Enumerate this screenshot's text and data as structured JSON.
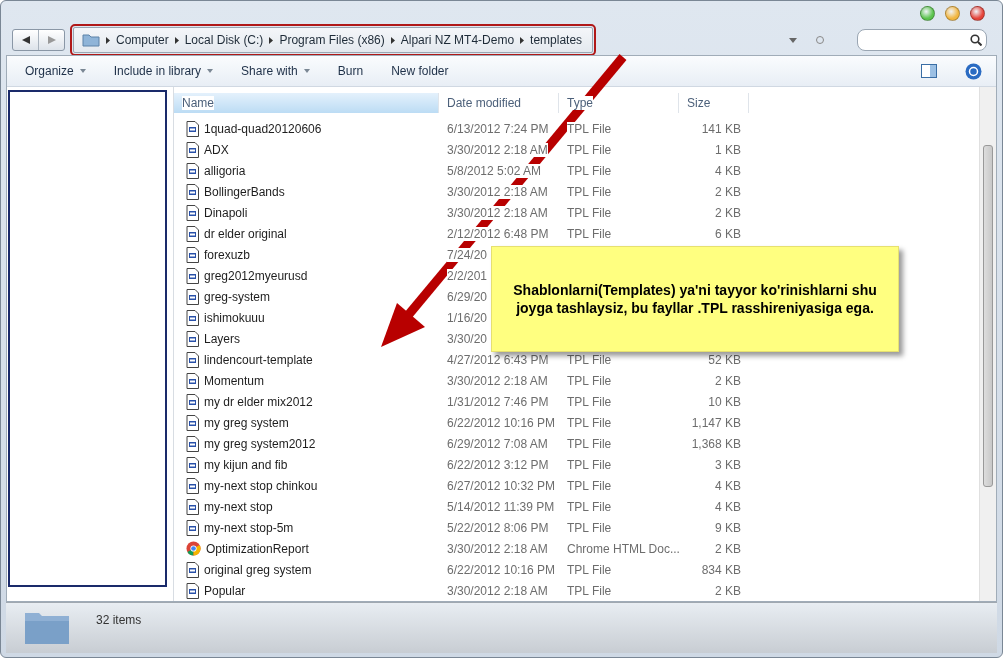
{
  "address": {
    "crumbs": [
      "Computer",
      "Local Disk (C:)",
      "Program Files (x86)",
      "Alpari NZ MT4-Demo",
      "templates"
    ]
  },
  "toolbar": [
    {
      "label": "Organize",
      "dropdown": true
    },
    {
      "label": "Include in library",
      "dropdown": true
    },
    {
      "label": "Share with",
      "dropdown": true
    },
    {
      "label": "Burn",
      "dropdown": false
    },
    {
      "label": "New folder",
      "dropdown": false
    }
  ],
  "columns": [
    {
      "label": "Name",
      "selected": true
    },
    {
      "label": "Date modified",
      "selected": false
    },
    {
      "label": "Type",
      "selected": false
    },
    {
      "label": "Size",
      "selected": false
    }
  ],
  "rows": [
    {
      "kind": "tpl",
      "name": "1quad-quad20120606",
      "date": "6/13/2012 7:24 PM",
      "type": "TPL File",
      "size": "141 KB"
    },
    {
      "kind": "tpl",
      "name": "ADX",
      "date": "3/30/2012 2:18 AM",
      "type": "TPL File",
      "size": "1 KB"
    },
    {
      "kind": "tpl",
      "name": "alligoria",
      "date": "5/8/2012 5:02 AM",
      "type": "TPL File",
      "size": "4 KB"
    },
    {
      "kind": "tpl",
      "name": "BollingerBands",
      "date": "3/30/2012 2:18 AM",
      "type": "TPL File",
      "size": "2 KB"
    },
    {
      "kind": "tpl",
      "name": "Dinapoli",
      "date": "3/30/2012 2:18 AM",
      "type": "TPL File",
      "size": "2 KB"
    },
    {
      "kind": "tpl",
      "name": "dr elder original",
      "date": "2/12/2012 6:48 PM",
      "type": "TPL File",
      "size": "6 KB"
    },
    {
      "kind": "tpl",
      "name": "forexuzb",
      "date": "7/24/20"
    },
    {
      "kind": "tpl",
      "name": "greg2012myeurusd",
      "date": "2/2/201"
    },
    {
      "kind": "tpl",
      "name": "greg-system",
      "date": "6/29/20"
    },
    {
      "kind": "tpl",
      "name": "ishimokuuu",
      "date": "1/16/20"
    },
    {
      "kind": "tpl",
      "name": "Layers",
      "date": "3/30/20"
    },
    {
      "kind": "tpl",
      "name": "lindencourt-template",
      "date": "4/27/2012 6:43 PM",
      "type": "TPL File",
      "size": "52 KB"
    },
    {
      "kind": "tpl",
      "name": "Momentum",
      "date": "3/30/2012 2:18 AM",
      "type": "TPL File",
      "size": "2 KB"
    },
    {
      "kind": "tpl",
      "name": "my dr elder mix2012",
      "date": "1/31/2012 7:46 PM",
      "type": "TPL File",
      "size": "10 KB"
    },
    {
      "kind": "tpl",
      "name": "my greg system",
      "date": "6/22/2012 10:16 PM",
      "type": "TPL File",
      "size": "1,147 KB"
    },
    {
      "kind": "tpl",
      "name": "my greg system2012",
      "date": "6/29/2012 7:08 AM",
      "type": "TPL File",
      "size": "1,368 KB"
    },
    {
      "kind": "tpl",
      "name": "my kijun and fib",
      "date": "6/22/2012 3:12 PM",
      "type": "TPL File",
      "size": "3 KB"
    },
    {
      "kind": "tpl",
      "name": "my-next stop chinkou",
      "date": "6/27/2012 10:32 PM",
      "type": "TPL File",
      "size": "4 KB"
    },
    {
      "kind": "tpl",
      "name": "my-next stop",
      "date": "5/14/2012 11:39 PM",
      "type": "TPL File",
      "size": "4 KB"
    },
    {
      "kind": "tpl",
      "name": "my-next stop-5m",
      "date": "5/22/2012 8:06 PM",
      "type": "TPL File",
      "size": "9 KB"
    },
    {
      "kind": "chrome",
      "name": "OptimizationReport",
      "date": "3/30/2012 2:18 AM",
      "type": "Chrome HTML Doc...",
      "size": "2 KB"
    },
    {
      "kind": "tpl",
      "name": "original greg system",
      "date": "6/22/2012 10:16 PM",
      "type": "TPL File",
      "size": "834 KB"
    },
    {
      "kind": "tpl",
      "name": "Popular",
      "date": "3/30/2012 2:18 AM",
      "type": "TPL File",
      "size": "2 KB"
    }
  ],
  "callout": {
    "text": "Shablonlarni(Templates) ya'ni tayyor ko'rinishlarni shu joyga tashlaysiz, bu fayllar .TPL rasshireniyasiga ega."
  },
  "status_bar": {
    "count": "32 items"
  }
}
